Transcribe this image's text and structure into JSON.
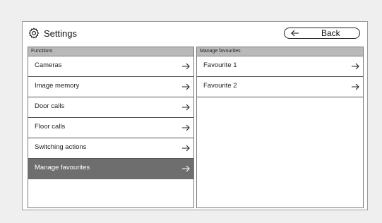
{
  "header": {
    "title": "Settings",
    "title_icon": "gear-icon",
    "back_label": "Back",
    "back_icon": "arrow-left-icon"
  },
  "functions_panel": {
    "header": "Functions",
    "items": [
      {
        "label": "Cameras"
      },
      {
        "label": "Image memory"
      },
      {
        "label": "Door calls"
      },
      {
        "label": "Floor calls"
      },
      {
        "label": "Switching actions"
      },
      {
        "label": "Manage favourites",
        "selected": true
      }
    ]
  },
  "favourites_panel": {
    "header": "Manage favourites",
    "items": [
      {
        "label": "Favourite 1"
      },
      {
        "label": "Favourite 2"
      }
    ]
  },
  "colors": {
    "page_background": "#efefef",
    "panel_header": "#b9b9b9",
    "selected_item": "#6e6e6e"
  }
}
